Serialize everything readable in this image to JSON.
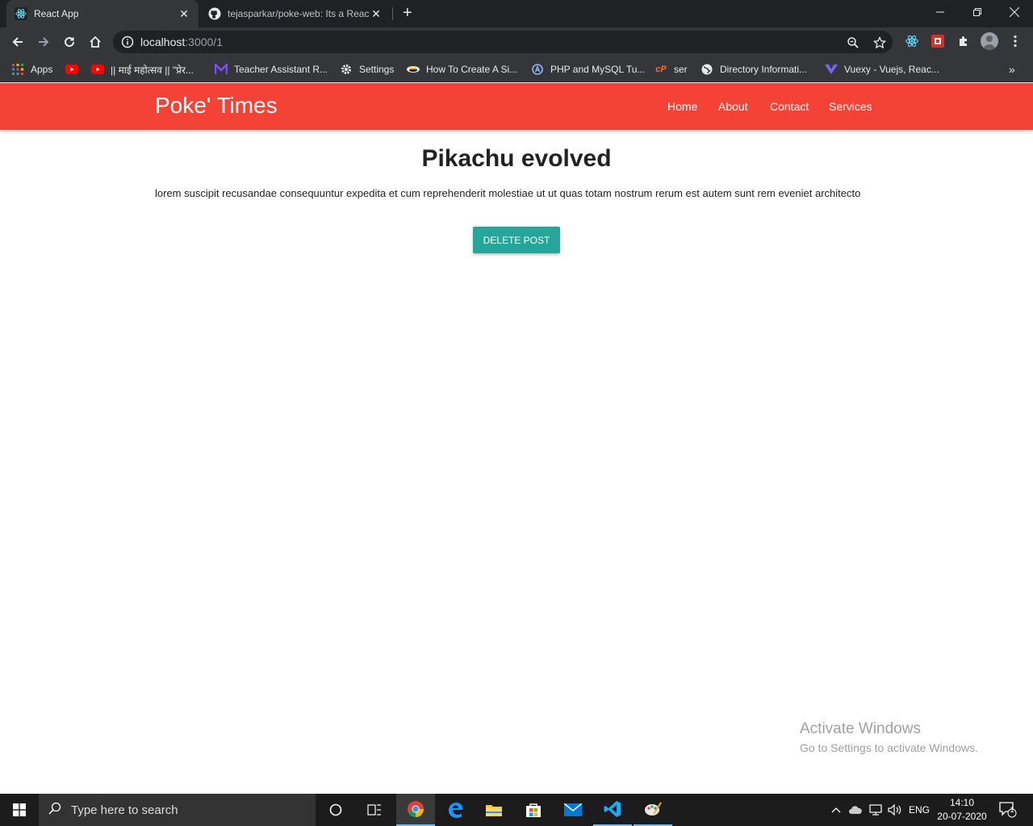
{
  "browser": {
    "tabs": [
      {
        "title": "React App",
        "active": true
      },
      {
        "title": "tejasparkar/poke-web: Its a React",
        "active": false
      }
    ],
    "url_host": "localhost",
    "url_path": ":3000/1",
    "bookmarks": [
      {
        "label": "Apps",
        "icon": "apps-grid-icon"
      },
      {
        "label": "",
        "icon": "youtube-icon"
      },
      {
        "label": "|| माई महोत्सव || \"प्रेर...",
        "icon": "youtube-icon"
      },
      {
        "label": "Teacher Assistant R...",
        "icon": "m-logo-icon"
      },
      {
        "label": "Settings",
        "icon": "gear-icon"
      },
      {
        "label": "How To Create A Si...",
        "icon": "site-icon"
      },
      {
        "label": "PHP and MySQL Tu...",
        "icon": "site-icon"
      },
      {
        "label": "ser",
        "icon": "cpanel-icon"
      },
      {
        "label": "Directory Informati...",
        "icon": "globe-icon"
      },
      {
        "label": "Vuexy - Vuejs, Reac...",
        "icon": "vuexy-icon"
      }
    ]
  },
  "site": {
    "brand": "Poke' Times",
    "nav": [
      "Home",
      "About",
      "Contact",
      "Services"
    ],
    "nav_color": "#f44336"
  },
  "post": {
    "title": "Pikachu evolved",
    "body": "lorem suscipit recusandae consequuntur expedita et cum reprehenderit molestiae ut ut quas totam nostrum rerum est autem sunt rem eveniet architecto",
    "delete_label": "DELETE POST",
    "button_color": "#26a69a"
  },
  "watermark": {
    "line1": "Activate Windows",
    "line2": "Go to Settings to activate Windows."
  },
  "taskbar": {
    "search_placeholder": "Type here to search",
    "lang": "ENG",
    "time": "14:10",
    "date": "20-07-2020",
    "notification_count": "1"
  }
}
